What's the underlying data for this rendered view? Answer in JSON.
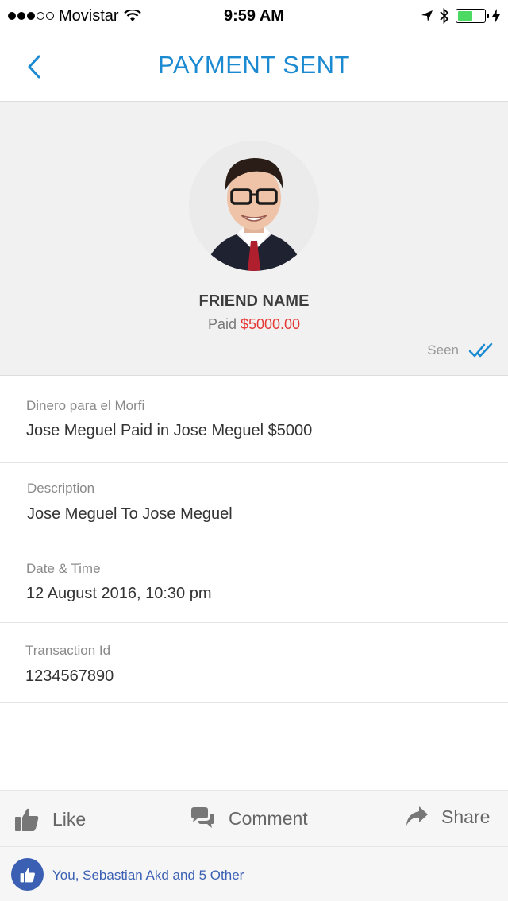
{
  "status_bar": {
    "carrier": "Movistar",
    "time": "9:59 AM",
    "battery_level": 0.55
  },
  "nav": {
    "title": "PAYMENT SENT",
    "back_icon": "chevron-left-icon",
    "accent_color": "#1b8ad1"
  },
  "profile": {
    "name": "FRIEND NAME",
    "paid_label": "Paid",
    "paid_amount": "$5000.00",
    "seen_label": "Seen",
    "amount_color": "#e53935"
  },
  "details": [
    {
      "label": "Dinero para el Morfi",
      "value": "Jose Meguel Paid in Jose Meguel $5000"
    },
    {
      "label": "Description",
      "value": "Jose Meguel  To  Jose Meguel"
    },
    {
      "label": "Date & Time",
      "value": "12 August 2016, 10:30 pm"
    },
    {
      "label": "Transaction Id",
      "value": "1234567890"
    }
  ],
  "actions": {
    "like": "Like",
    "comment": "Comment",
    "share": "Share"
  },
  "likes_summary": "You, Sebastian Akd and 5 Other"
}
